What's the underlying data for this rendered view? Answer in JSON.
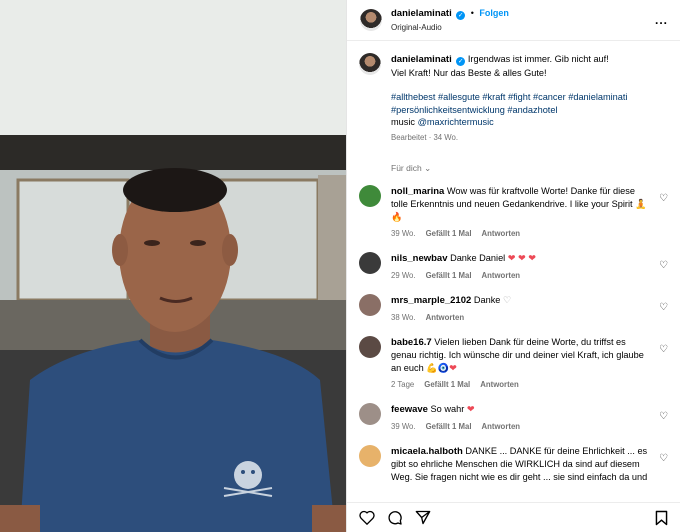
{
  "header": {
    "username": "danielaminati",
    "verified_mark": "✓",
    "separator": "•",
    "follow": "Folgen",
    "audio": "Original-Audio",
    "more": "..."
  },
  "caption": {
    "username": "danielaminati",
    "line1": "Irgendwas ist immer. Gib nicht auf!",
    "line2": "Viel Kraft! Nur das Beste & alles Gute!",
    "tags1": "#allthebest #allesgute #kraft #fight #cancer #danielaminati",
    "tags2": "#persönlichkeitsentwicklung #andazhotel",
    "music_label": "music",
    "music_handle": "@maxrichtermusic",
    "edited": "Bearbeitet · 34 Wo."
  },
  "for_you": "Für dich",
  "comments": [
    {
      "user": "noll_marina",
      "text": "Wow was für kraftvolle Worte! Danke für diese tolle Erkenntnis und neuen Gedankendrive. I like your Spirit",
      "emoji": "🧘🔥",
      "time": "39 Wo.",
      "likes": "Gefällt 1 Mal",
      "reply": "Antworten",
      "avatar_color": "#3f8a3a"
    },
    {
      "user": "nils_newbav",
      "text": "Danke Daniel",
      "emoji": "❤ ❤ ❤",
      "time": "29 Wo.",
      "likes": "Gefällt 1 Mal",
      "reply": "Antworten",
      "avatar_color": "#3a3a3a"
    },
    {
      "user": "mrs_marple_2102",
      "text": "Danke",
      "emoji": "♡",
      "time": "38 Wo.",
      "likes": "",
      "reply": "Antworten",
      "avatar_color": "#8a6f66"
    },
    {
      "user": "babe16.7",
      "text": "Vielen lieben Dank für deine Worte, du triffst es genau richtig. Ich wünsche dir und deiner viel Kraft, ich glaube an euch",
      "emoji": "💪🧿❤",
      "time": "2 Tage",
      "likes": "Gefällt 1 Mal",
      "reply": "Antworten",
      "avatar_color": "#5b4a44"
    },
    {
      "user": "feewave",
      "text": "So wahr",
      "emoji": "❤",
      "time": "39 Wo.",
      "likes": "Gefällt 1 Mal",
      "reply": "Antworten",
      "avatar_color": "#9d8f88"
    },
    {
      "user": "micaela.halboth",
      "text": "DANKE ... DANKE für deine Ehrlichkeit ... es gibt so ehrliche Menschen die WIRKLICH da sind auf diesem Weg. Sie fragen nicht wie es dir geht ... sie sind einfach da und",
      "emoji": "",
      "time": "",
      "likes": "",
      "reply": "",
      "avatar_color": "#e7b26a"
    }
  ],
  "colors": {
    "accent": "#0095f6",
    "heart": "#ed4956",
    "muted": "#737373"
  }
}
